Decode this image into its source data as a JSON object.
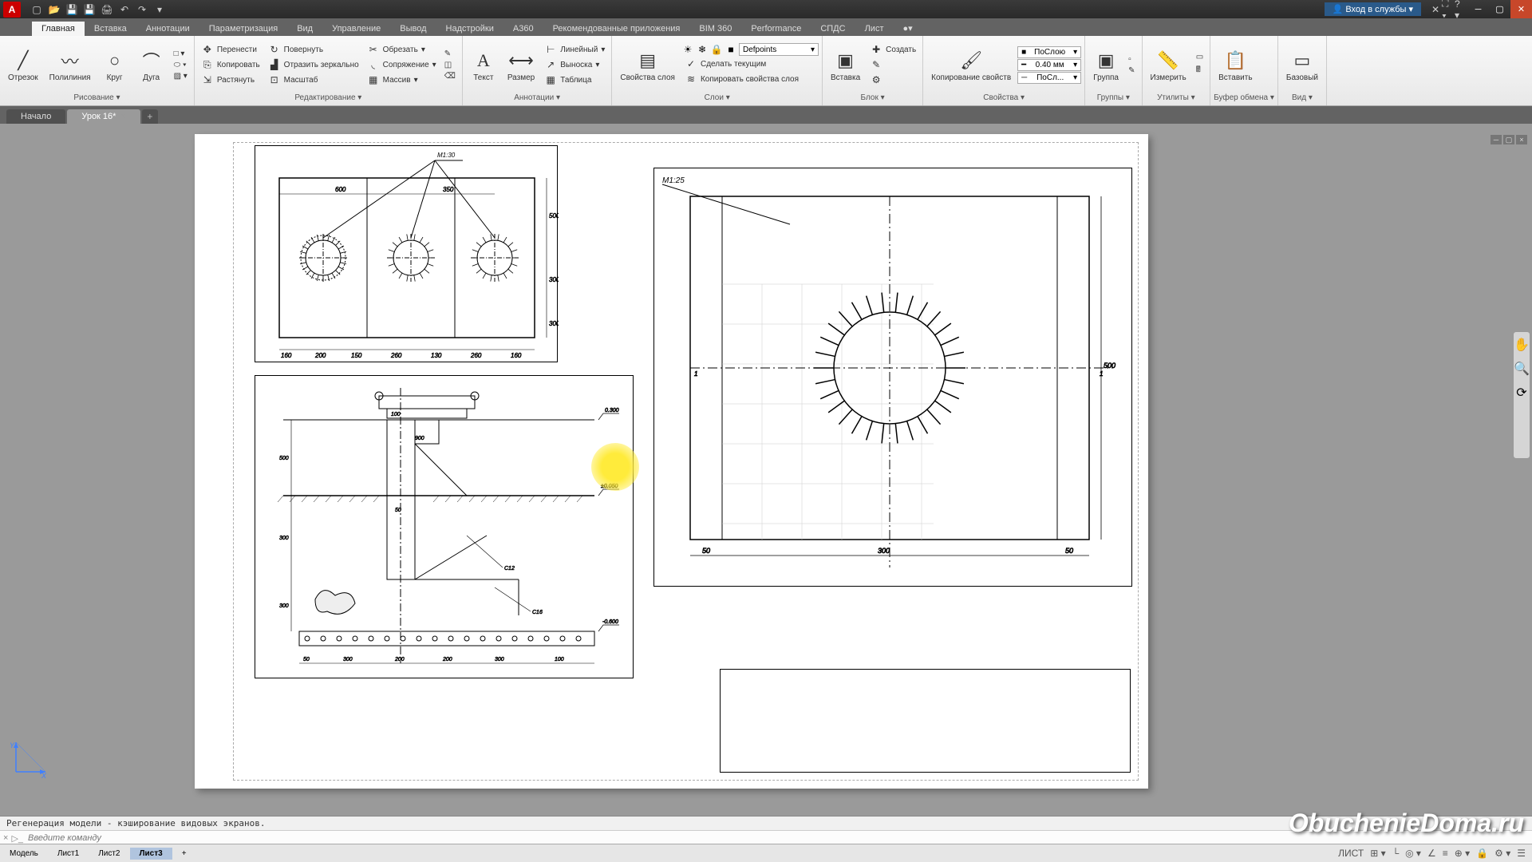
{
  "app": {
    "logo": "A"
  },
  "qat": [
    "new",
    "open",
    "save",
    "saveas",
    "print",
    "undo",
    "redo"
  ],
  "login": "Вход в службы",
  "help_items": [
    "✕",
    "⛶",
    "?",
    "▾"
  ],
  "ribbon_tabs": [
    "Главная",
    "Вставка",
    "Аннотации",
    "Параметризация",
    "Вид",
    "Управление",
    "Вывод",
    "Надстройки",
    "A360",
    "Рекомендованные приложения",
    "BIM 360",
    "Performance",
    "СПДС",
    "Лист",
    "●▾"
  ],
  "active_ribbon_tab": 0,
  "panels": {
    "draw": {
      "label": "Рисование ▾",
      "buttons": [
        {
          "name": "line",
          "label": "Отрезок",
          "icon": "╱"
        },
        {
          "name": "polyline",
          "label": "Полилиния",
          "icon": "〰"
        },
        {
          "name": "circle",
          "label": "Круг",
          "icon": "○"
        },
        {
          "name": "arc",
          "label": "Дуга",
          "icon": "⌒"
        }
      ],
      "small": [
        "□",
        "⬭",
        "⬡",
        "·",
        "A"
      ]
    },
    "modify": {
      "label": "Редактирование ▾",
      "rows": [
        [
          {
            "name": "move",
            "label": "Перенести",
            "icon": "✥"
          },
          {
            "name": "rotate",
            "label": "Повернуть",
            "icon": "↻"
          },
          {
            "name": "trim",
            "label": "Обрезать",
            "icon": "✂",
            "drop": "▾"
          }
        ],
        [
          {
            "name": "copy",
            "label": "Копировать",
            "icon": "⎘"
          },
          {
            "name": "mirror",
            "label": "Отразить зеркально",
            "icon": "▟"
          },
          {
            "name": "fillet",
            "label": "Сопряжение",
            "icon": "◟",
            "drop": "▾"
          }
        ],
        [
          {
            "name": "stretch",
            "label": "Растянуть",
            "icon": "⇲"
          },
          {
            "name": "scale",
            "label": "Масштаб",
            "icon": "⊡"
          },
          {
            "name": "array",
            "label": "Массив",
            "icon": "▦",
            "drop": "▾"
          }
        ]
      ],
      "extras": [
        "✎",
        "◫",
        "⟳",
        "✂",
        "☰"
      ]
    },
    "annot": {
      "label": "Аннотации ▾",
      "text": {
        "name": "text",
        "label": "Текст",
        "icon": "A"
      },
      "dim": {
        "name": "dimension",
        "label": "Размер",
        "icon": "↔"
      },
      "rows": [
        {
          "name": "linear",
          "label": "Линейный",
          "icon": "⊢",
          "drop": "▾"
        },
        {
          "name": "leader",
          "label": "Выноска",
          "icon": "↗",
          "drop": "▾"
        },
        {
          "name": "table",
          "label": "Таблица",
          "icon": "▦"
        }
      ]
    },
    "layers": {
      "label": "Слои ▾",
      "main": {
        "name": "layer-props",
        "label": "Свойства слоя",
        "icon": "▤"
      },
      "combo": "Defpoints",
      "state_icons": [
        "☀",
        "❄",
        "🔒",
        "🎨",
        "⬜"
      ],
      "row2": [
        {
          "name": "make-current",
          "label": "Сделать текущим",
          "icon": "✓"
        }
      ],
      "row3": [
        {
          "name": "match-layer",
          "label": "Копировать свойства слоя",
          "icon": "≋"
        }
      ]
    },
    "block": {
      "label": "Блок ▾",
      "main": {
        "name": "insert",
        "label": "Вставка",
        "icon": "▣"
      },
      "rows": [
        {
          "name": "create",
          "label": "Создать",
          "icon": "✚"
        },
        {
          "name": "edit",
          "label": "",
          "icon": "✎"
        },
        {
          "name": "attr",
          "label": "",
          "icon": "⚙"
        }
      ]
    },
    "props": {
      "label": "Свойства ▾",
      "main": {
        "name": "match-props",
        "label": "Копирование свойств",
        "icon": "🖌"
      },
      "combos": [
        {
          "name": "color",
          "value": "ПоСлою",
          "swatch": "#fff"
        },
        {
          "name": "lineweight",
          "value": "0.40 мм"
        },
        {
          "name": "linetype",
          "value": "ПоСл..."
        }
      ]
    },
    "groups": {
      "label": "Группы ▾",
      "main": {
        "name": "group",
        "label": "Группа",
        "icon": "▣"
      }
    },
    "utils": {
      "label": "Утилиты ▾",
      "main": {
        "name": "measure",
        "label": "Измерить",
        "icon": "📏"
      }
    },
    "clip": {
      "label": "Буфер обмена ▾",
      "main": {
        "name": "paste",
        "label": "Вставить",
        "icon": "📋"
      }
    },
    "view": {
      "label": "Вид ▾",
      "main": {
        "name": "base",
        "label": "Базовый",
        "icon": "▭"
      }
    }
  },
  "doc_tabs": [
    {
      "label": "Начало",
      "active": false,
      "close": false
    },
    {
      "label": "Урок 16*",
      "active": true,
      "close": true
    }
  ],
  "cmd_history": "Регенерация модели - кэширование видовых экранов.",
  "cmd_placeholder": "Введите команду",
  "cmd_close": "×",
  "layout_tabs": [
    "Модель",
    "Лист1",
    "Лист2",
    "Лист3"
  ],
  "active_layout": 3,
  "status_mode": "ЛИСТ",
  "status_icons": [
    "⊞",
    "▦",
    "└",
    "◎",
    "∠",
    "✂",
    "≡",
    "⊕",
    "☰",
    "▾",
    "⚙",
    "≡"
  ],
  "watermark": "ObuchenieDoma.ru",
  "drawing": {
    "vp1": {
      "label": "М1:30",
      "dims": [
        "600",
        "350",
        "500",
        "300",
        "300",
        "160",
        "200",
        "150",
        "260",
        "130",
        "260",
        "160"
      ]
    },
    "vp2": {
      "label": "М1:25",
      "dims": [
        "50",
        "300",
        "50",
        "500"
      ]
    },
    "vp3": {
      "dims": [
        "0.300",
        "±0.050",
        "-0.600",
        "50",
        "300",
        "200",
        "200",
        "300",
        "100",
        "500",
        "300",
        "300",
        "100",
        "900",
        "C12",
        "C16"
      ]
    }
  }
}
